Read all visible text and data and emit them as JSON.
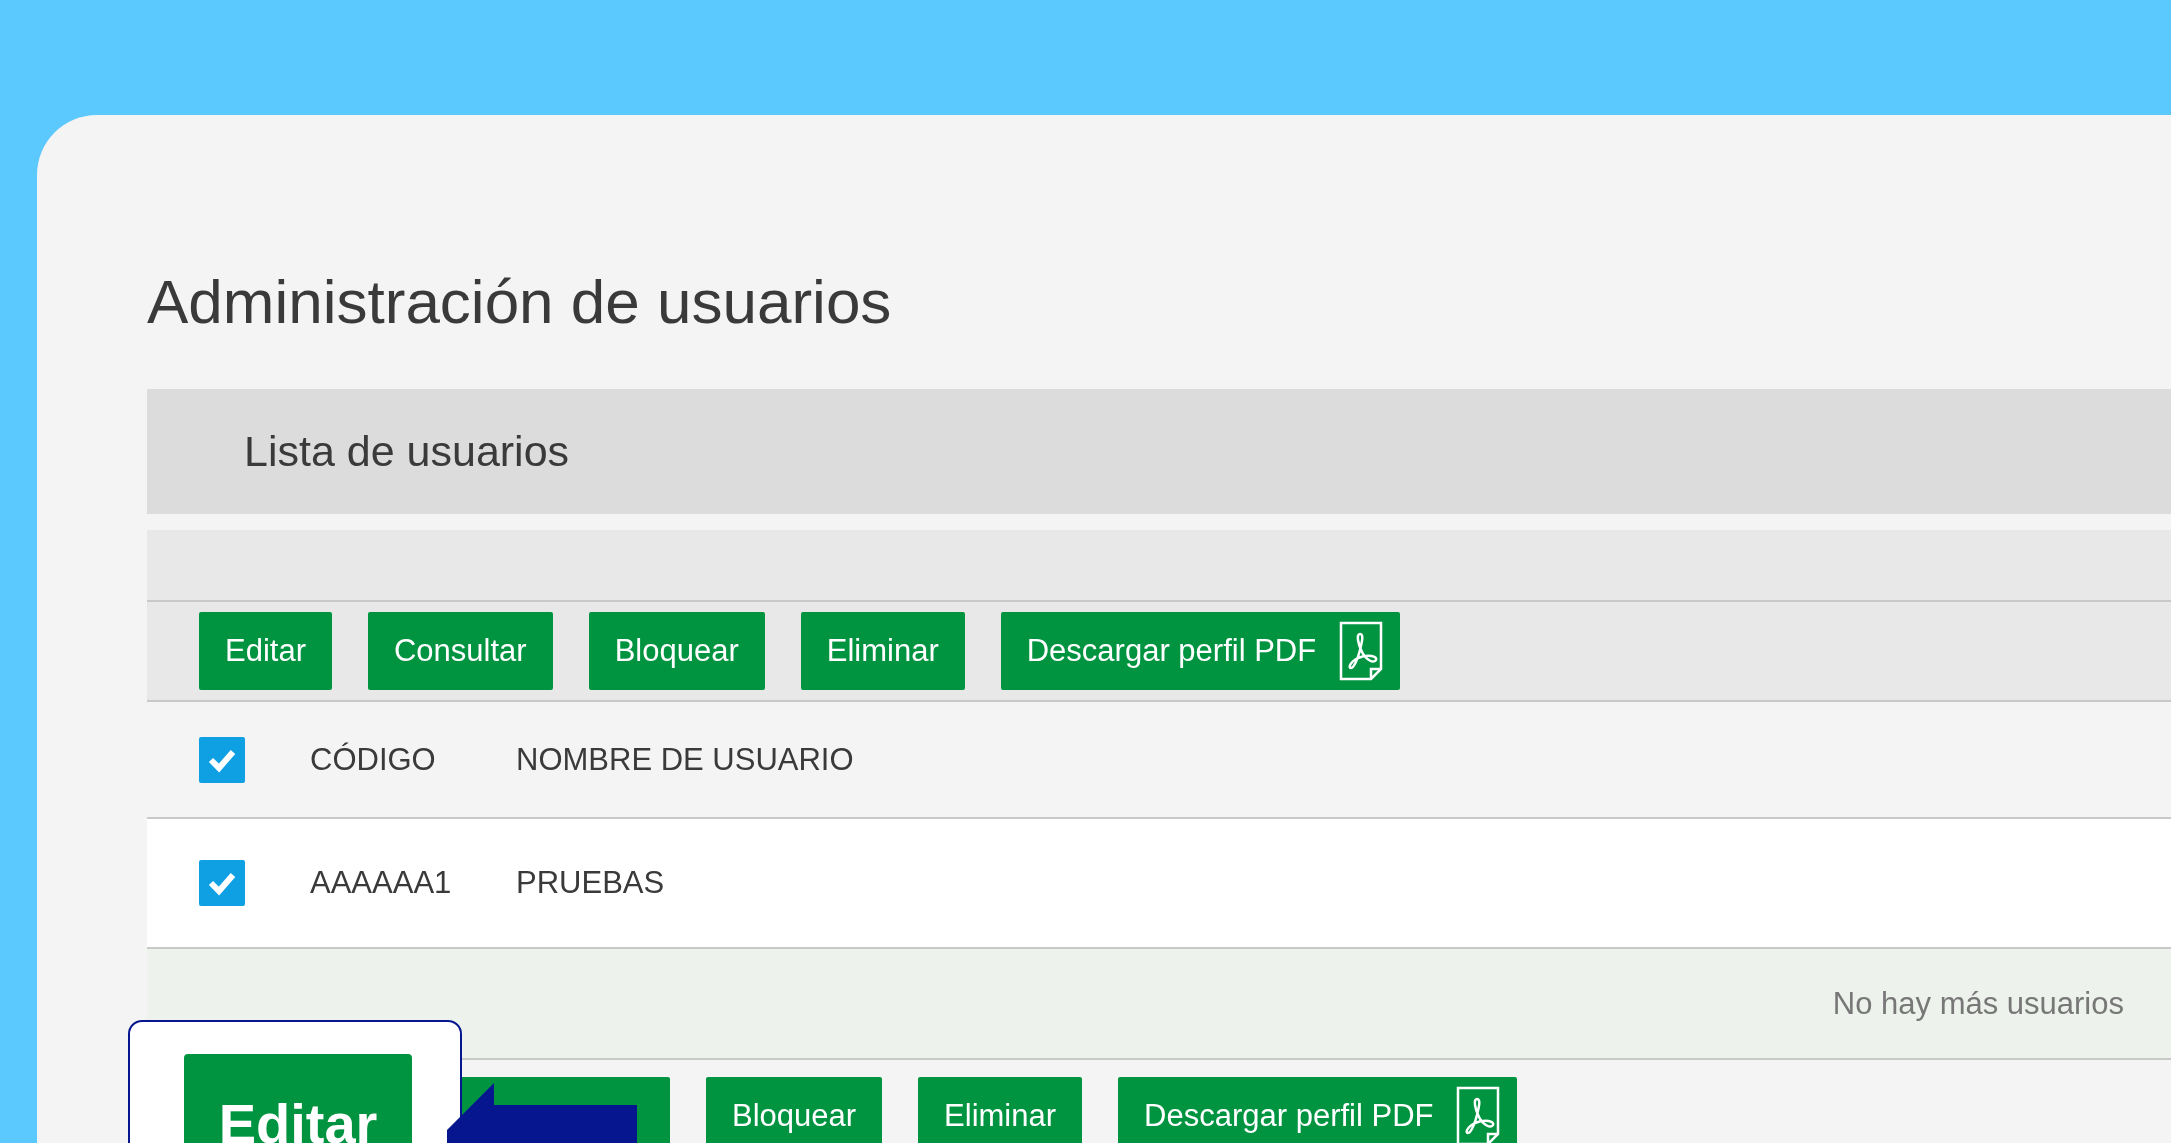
{
  "title": "Administración de usuarios",
  "panel": {
    "title": "Lista de usuarios"
  },
  "toolbar_top": [
    {
      "label": "Editar",
      "kind": "text"
    },
    {
      "label": "Consultar",
      "kind": "text"
    },
    {
      "label": "Bloquear",
      "kind": "text"
    },
    {
      "label": "Eliminar",
      "kind": "text"
    },
    {
      "label": "Descargar perfil PDF",
      "kind": "pdf"
    }
  ],
  "table": {
    "header": {
      "checked": true,
      "columns": [
        "CÓDIGO",
        "NOMBRE DE USUARIO"
      ]
    },
    "rows": [
      {
        "checked": true,
        "cells": [
          "AAAAAA1",
          "PRUEBAS"
        ]
      }
    ]
  },
  "footer_note": "No hay más usuarios",
  "toolbar_bottom": [
    {
      "kind": "hidden"
    },
    {
      "kind": "covered"
    },
    {
      "label": "Bloquear",
      "kind": "text"
    },
    {
      "label": "Eliminar",
      "kind": "text"
    },
    {
      "label": "Descargar perfil PDF",
      "kind": "pdf"
    }
  ],
  "callout": {
    "button": "Editar"
  }
}
